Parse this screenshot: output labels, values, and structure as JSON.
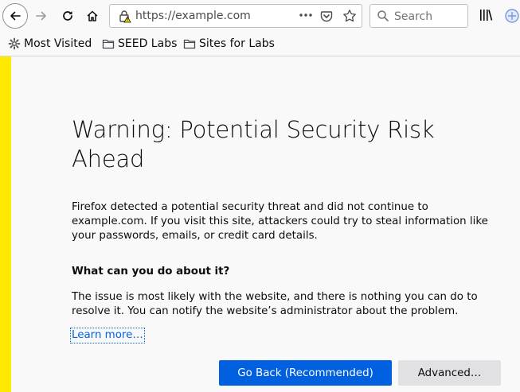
{
  "toolbar": {
    "url": "https://example.com",
    "search_placeholder": "Search"
  },
  "bookmarks": [
    {
      "label": "Most Visited",
      "icon": "gear-icon"
    },
    {
      "label": "SEED Labs",
      "icon": "folder-icon"
    },
    {
      "label": "Sites for Labs",
      "icon": "folder-icon"
    }
  ],
  "page": {
    "title": "Warning: Potential Security Risk Ahead",
    "intro": "Firefox detected a potential security threat and did not continue to example.com. If you visit this site, attackers could try to steal information like your passwords, emails, or credit card details.",
    "question": "What can you do about it?",
    "advice": "The issue is most likely with the website, and there is nothing you can do to resolve it. You can notify the website’s administrator about the problem.",
    "learn_more": "Learn more…",
    "go_back_label": "Go Back (Recommended)",
    "advanced_label": "Advanced…"
  },
  "colors": {
    "warning_stripe": "#ffe900",
    "primary_button": "#0060df",
    "link": "#0060df"
  }
}
